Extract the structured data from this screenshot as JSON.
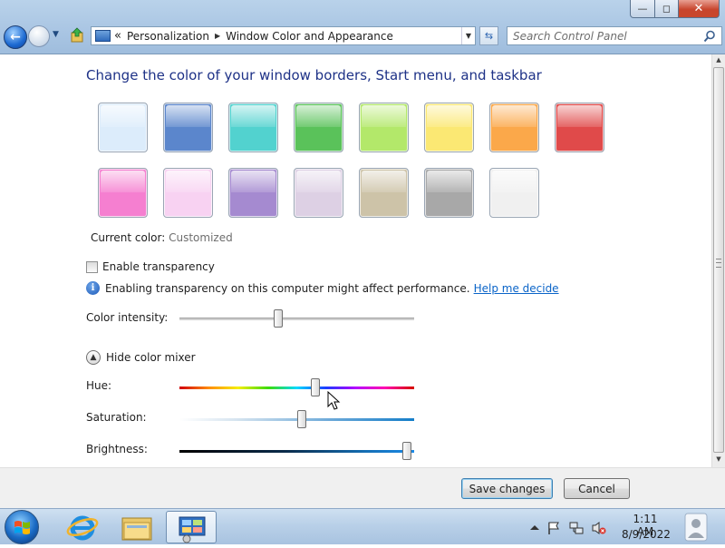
{
  "window": {
    "controls": {
      "minimize": "—",
      "maximize": "◻",
      "close": "✕"
    }
  },
  "nav": {
    "back_icon": "back-arrow-icon",
    "forward_icon": "forward-arrow-icon"
  },
  "address": {
    "chevron": "«",
    "crumbs": [
      "Personalization",
      "Window Color and Appearance"
    ],
    "separator": "▶"
  },
  "search": {
    "placeholder": "Search Control Panel"
  },
  "page": {
    "title": "Change the color of your window borders, Start menu, and taskbar",
    "current_color_label": "Current color:",
    "current_color_value": "Customized",
    "transparency_label": "Enable transparency",
    "transparency_checked": false,
    "info_text": "Enabling transparency on this computer might affect performance.",
    "help_link": "Help me decide",
    "intensity_label": "Color intensity:",
    "intensity_value": 0.42,
    "mixer_toggle_label": "Hide color mixer",
    "hue_label": "Hue:",
    "hue_value": 0.58,
    "saturation_label": "Saturation:",
    "saturation_value": 0.52,
    "brightness_label": "Brightness:",
    "brightness_value": 0.97
  },
  "swatches": [
    {
      "name": "sky",
      "color": "#dcecfb"
    },
    {
      "name": "twilight",
      "color": "#5b86cc"
    },
    {
      "name": "sea",
      "color": "#52d2cf"
    },
    {
      "name": "leaf",
      "color": "#5ac25a"
    },
    {
      "name": "lime",
      "color": "#b3e86a"
    },
    {
      "name": "lemon",
      "color": "#fbe873"
    },
    {
      "name": "tangerine",
      "color": "#fba84a"
    },
    {
      "name": "ruby",
      "color": "#e04a4a"
    },
    {
      "name": "fuchsia",
      "color": "#f57fd0"
    },
    {
      "name": "blush",
      "color": "#f8d2f2"
    },
    {
      "name": "violet",
      "color": "#a58ad0"
    },
    {
      "name": "lavender",
      "color": "#ddd0e4"
    },
    {
      "name": "taupe",
      "color": "#cdc3a8"
    },
    {
      "name": "chocolate",
      "color": "#a8a8a8"
    },
    {
      "name": "frost",
      "color": "#f0f0f0"
    }
  ],
  "buttons": {
    "save": "Save changes",
    "cancel": "Cancel"
  },
  "taskbar": {
    "time": "1:11 AM",
    "date": "8/9/2022"
  }
}
